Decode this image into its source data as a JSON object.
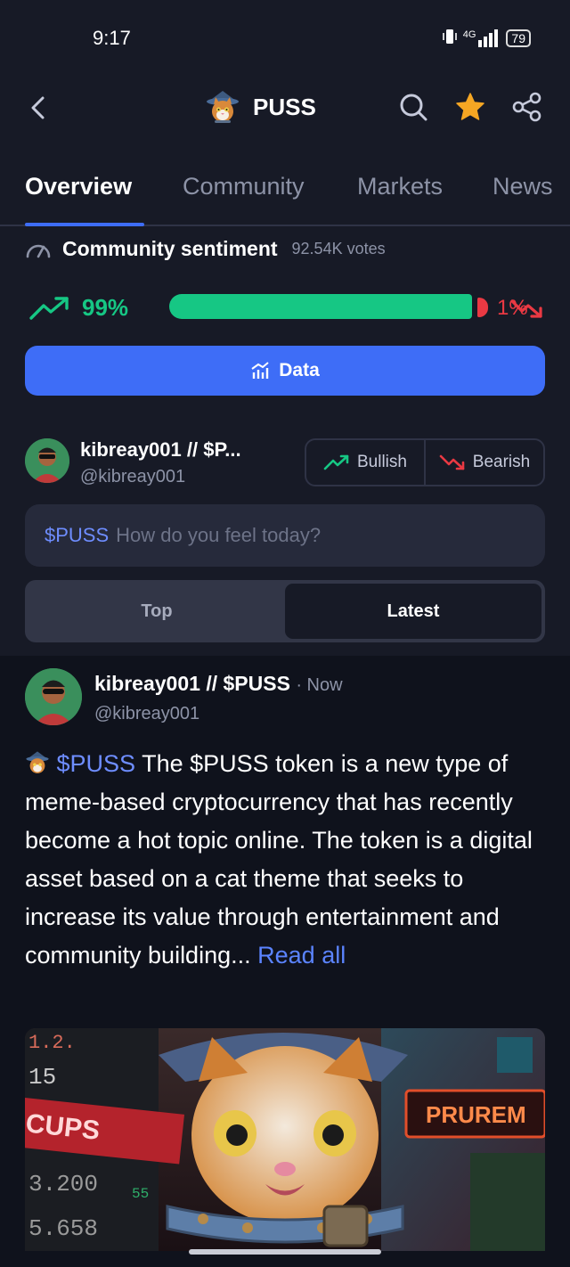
{
  "status_bar": {
    "time": "9:17",
    "network": "4G",
    "battery": "79"
  },
  "header": {
    "title": "PUSS",
    "icons": [
      "back-icon",
      "search-icon",
      "star-icon",
      "share-icon"
    ],
    "colors": {
      "star": "#f5a623"
    }
  },
  "tabs": [
    {
      "label": "Overview",
      "active": true
    },
    {
      "label": "Community",
      "active": false
    },
    {
      "label": "Markets",
      "active": false
    },
    {
      "label": "News",
      "active": false
    }
  ],
  "sentiment": {
    "title": "Community sentiment",
    "votes": "92.54K votes",
    "bullish_pct_label": "99%",
    "bearish_pct_label": "1%",
    "bullish_fraction": 0.99,
    "colors": {
      "bullish": "#16c784",
      "bearish": "#ea3943"
    }
  },
  "data_button": {
    "label": "Data",
    "color": "#3e6df7"
  },
  "composer": {
    "user_name": "kibreay001 // $P...",
    "user_handle": "@kibreay001",
    "bullish_label": "Bullish",
    "bearish_label": "Bearish",
    "cashtag": "$PUSS",
    "placeholder": "How do you feel today?"
  },
  "sort": {
    "options": [
      "Top",
      "Latest"
    ],
    "selected": "Latest"
  },
  "post": {
    "user_name": "kibreay001 // $PUSS",
    "time": "· Now",
    "user_handle": "@kibreay001",
    "cashtag": "$PUSS",
    "body": "The $PUSS token is a new type of meme-based cryptocurrency that has recently become a hot topic online. The token is a digital asset based on a cat theme that seeks to increase its value through entertainment and community building...",
    "read_all": "Read all",
    "image_texts": [
      "CUPS",
      "PRUREM"
    ]
  }
}
